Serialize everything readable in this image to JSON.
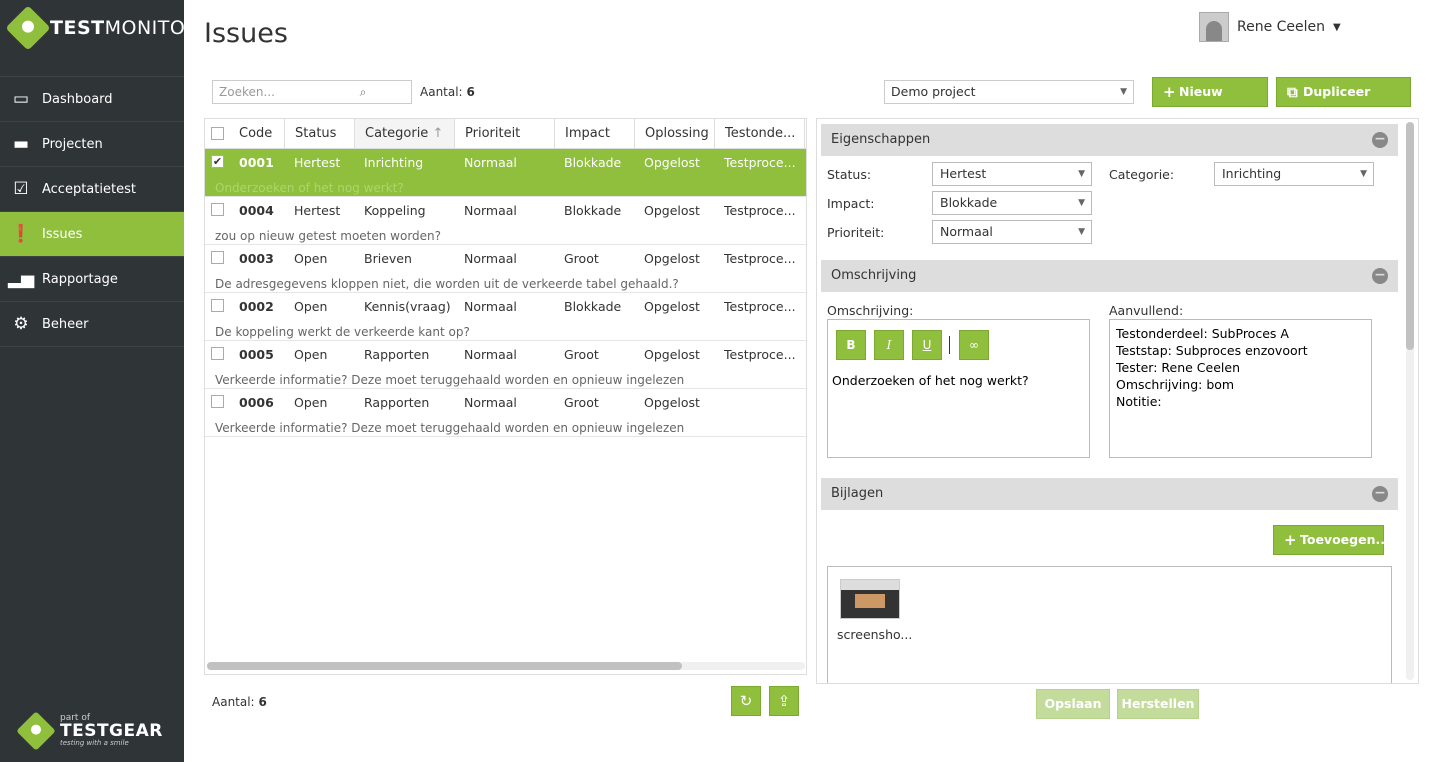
{
  "brand": {
    "name_bold": "TEST",
    "name_rest": "MONITOR",
    "footer_small": "part of",
    "footer_brand": "TESTGEAR",
    "footer_tagline": "testing with a smile"
  },
  "nav": [
    {
      "label": "Dashboard",
      "icon": "monitor-icon"
    },
    {
      "label": "Projecten",
      "icon": "folder-icon"
    },
    {
      "label": "Acceptatietest",
      "icon": "clipboard-check-icon"
    },
    {
      "label": "Issues",
      "icon": "alert-icon",
      "active": true
    },
    {
      "label": "Rapportage",
      "icon": "bar-chart-icon"
    },
    {
      "label": "Beheer",
      "icon": "gear-icon"
    }
  ],
  "page": {
    "title": "Issues"
  },
  "user": {
    "name": "Rene Ceelen"
  },
  "search": {
    "placeholder": "Zoeken..."
  },
  "count": {
    "label": "Aantal:",
    "value": "6"
  },
  "project_select": {
    "value": "Demo project"
  },
  "buttons": {
    "new_issue": "Nieuw issue...",
    "duplicate_issue": "Dupliceer issue...",
    "add": "Toevoegen...",
    "save": "Opslaan",
    "reset": "Herstellen"
  },
  "grid": {
    "columns": [
      "Code",
      "Status",
      "Categorie",
      "Prioriteit",
      "Impact",
      "Oplossing",
      "Testonde..."
    ],
    "rows": [
      {
        "code": "0001",
        "status": "Hertest",
        "category": "Inrichting",
        "priority": "Normaal",
        "impact": "Blokkade",
        "solution": "Opgelost",
        "test": "Testproce...",
        "desc": "Onderzoeken of het nog werkt?",
        "selected": true
      },
      {
        "code": "0004",
        "status": "Hertest",
        "category": "Koppeling",
        "priority": "Normaal",
        "impact": "Blokkade",
        "solution": "Opgelost",
        "test": "Testproce...",
        "desc": "zou op nieuw getest moeten worden?"
      },
      {
        "code": "0003",
        "status": "Open",
        "category": "Brieven",
        "priority": "Normaal",
        "impact": "Groot",
        "solution": "Opgelost",
        "test": "Testproce...",
        "desc": "De adresgegevens kloppen niet, die worden uit de verkeerde tabel gehaald.?"
      },
      {
        "code": "0002",
        "status": "Open",
        "category": "Kennis(vraag)",
        "priority": "Normaal",
        "impact": "Blokkade",
        "solution": "Opgelost",
        "test": "Testproce...",
        "desc": "De koppeling werkt de verkeerde kant op?"
      },
      {
        "code": "0005",
        "status": "Open",
        "category": "Rapporten",
        "priority": "Normaal",
        "impact": "Groot",
        "solution": "Opgelost",
        "test": "Testproce...",
        "desc": "Verkeerde informatie? Deze moet teruggehaald worden en opnieuw ingelezen"
      },
      {
        "code": "0006",
        "status": "Open",
        "category": "Rapporten",
        "priority": "Normaal",
        "impact": "Groot",
        "solution": "Opgelost",
        "test": "",
        "desc": "Verkeerde informatie? Deze moet teruggehaald worden en opnieuw ingelezen"
      }
    ]
  },
  "props": {
    "title": "Eigenschappen",
    "status_label": "Status:",
    "status": "Hertest",
    "impact_label": "Impact:",
    "impact": "Blokkade",
    "priority_label": "Prioriteit:",
    "priority": "Normaal",
    "category_label": "Categorie:",
    "category": "Inrichting"
  },
  "description": {
    "title": "Omschrijving",
    "label": "Omschrijving:",
    "text": "Onderzoeken of het nog werkt?",
    "extra_label": "Aanvullend:",
    "extra_lines": [
      "Testonderdeel: SubProces A",
      "Teststap: Subproces enzovoort",
      "Tester: Rene Ceelen",
      "Omschrijving: bom",
      "Notitie:"
    ]
  },
  "attachments": {
    "title": "Bijlagen",
    "file": "screensho..."
  }
}
